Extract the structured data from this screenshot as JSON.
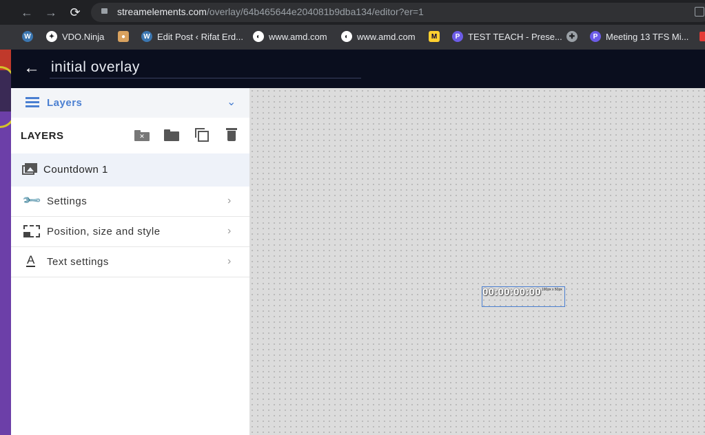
{
  "browser": {
    "url_domain": "streamelements.com",
    "url_path": "/overlay/64b465644e204081b9dba134/editor?er=1",
    "bookmarks": [
      {
        "label": "",
        "icon": "wordpress-icon"
      },
      {
        "label": "VDO.Ninja",
        "icon": "vdo-ninja-icon"
      },
      {
        "label": "",
        "icon": "cake-icon"
      },
      {
        "label": "Edit Post ‹ Rifat Erd...",
        "icon": "wordpress-icon"
      },
      {
        "label": "www.amd.com",
        "icon": "globe-icon"
      },
      {
        "label": "www.amd.com",
        "icon": "globe-icon"
      },
      {
        "label": "",
        "icon": "miro-icon"
      },
      {
        "label": "TEST TEACH - Prese...",
        "icon": "pear-deck-icon"
      },
      {
        "label": "",
        "icon": "puzzle-icon"
      },
      {
        "label": "Meeting 13 TFS Mi...",
        "icon": "pear-deck-icon"
      }
    ]
  },
  "header": {
    "title": "initial overlay"
  },
  "sidebar": {
    "dropdown_label": "Layers",
    "layers_title": "LAYERS",
    "layer_item": "Countdown 1",
    "rows": [
      {
        "label": "Settings",
        "icon": "wrench-icon"
      },
      {
        "label": "Position, size and style",
        "icon": "position-icon"
      },
      {
        "label": "Text settings",
        "icon": "text-icon"
      }
    ]
  },
  "canvas": {
    "timer_text": "00:00:00:00",
    "size_label": "100px x 50px"
  },
  "colors": {
    "accent": "#4a7fd1",
    "header_bg": "#0a0e1e"
  }
}
